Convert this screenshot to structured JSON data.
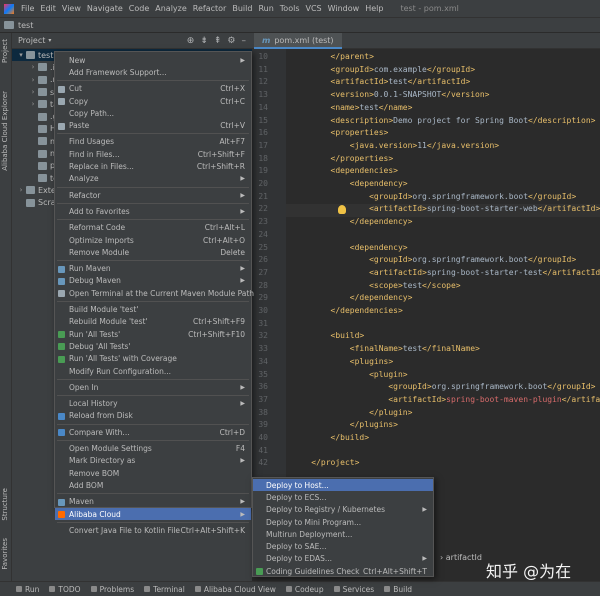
{
  "window": {
    "title": "test - pom.xml"
  },
  "menubar": [
    "File",
    "Edit",
    "View",
    "Navigate",
    "Code",
    "Analyze",
    "Refactor",
    "Build",
    "Run",
    "Tools",
    "VCS",
    "Window",
    "Help"
  ],
  "navbar": {
    "project": "test"
  },
  "left_tabs": [
    "Project",
    "Alibaba Cloud Explorer",
    "Structure",
    "Favorites"
  ],
  "project_panel": {
    "title": "Project",
    "tree": [
      {
        "label": "test",
        "arrow": "▾",
        "selected": true
      },
      {
        "label": ".id",
        "arrow": "›"
      },
      {
        "label": ".m",
        "arrow": "›"
      },
      {
        "label": "sr",
        "arrow": "›"
      },
      {
        "label": "ta",
        "arrow": "›"
      },
      {
        "label": ".gi",
        "arrow": ""
      },
      {
        "label": "HE",
        "arrow": ""
      },
      {
        "label": "m",
        "arrow": ""
      },
      {
        "label": "m",
        "arrow": ""
      },
      {
        "label": "pc",
        "arrow": ""
      },
      {
        "label": "te",
        "arrow": ""
      },
      {
        "label": "Exter",
        "arrow": "›"
      },
      {
        "label": "Scrat",
        "arrow": ""
      }
    ]
  },
  "editor": {
    "tab": "pom.xml (test)",
    "first_line": 10,
    "current_line": 22,
    "lines": [
      [
        {
          "c": "tag",
          "t": "        </parent>"
        }
      ],
      [
        {
          "c": "tag",
          "t": "        <groupId>"
        },
        {
          "c": "txt",
          "t": "com.example"
        },
        {
          "c": "tag",
          "t": "</groupId>"
        }
      ],
      [
        {
          "c": "tag",
          "t": "        <artifactId>"
        },
        {
          "c": "txt",
          "t": "test"
        },
        {
          "c": "tag",
          "t": "</artifactId>"
        }
      ],
      [
        {
          "c": "tag",
          "t": "        <version>"
        },
        {
          "c": "txt",
          "t": "0.0.1-SNAPSHOT"
        },
        {
          "c": "tag",
          "t": "</version>"
        }
      ],
      [
        {
          "c": "tag",
          "t": "        <name>"
        },
        {
          "c": "txt",
          "t": "test"
        },
        {
          "c": "tag",
          "t": "</name>"
        }
      ],
      [
        {
          "c": "tag",
          "t": "        <description>"
        },
        {
          "c": "txt",
          "t": "Demo project for Spring Boot"
        },
        {
          "c": "tag",
          "t": "</description>"
        }
      ],
      [
        {
          "c": "tag",
          "t": "        <properties>"
        }
      ],
      [
        {
          "c": "tag",
          "t": "            <java.version>"
        },
        {
          "c": "txt",
          "t": "11"
        },
        {
          "c": "tag",
          "t": "</java.version>"
        }
      ],
      [
        {
          "c": "tag",
          "t": "        </properties>"
        }
      ],
      [
        {
          "c": "tag",
          "t": "        <dependencies>"
        }
      ],
      [
        {
          "c": "tag",
          "t": "            <dependency>"
        }
      ],
      [
        {
          "c": "tag",
          "t": "                <groupId>"
        },
        {
          "c": "txt",
          "t": "org.springframework.boot"
        },
        {
          "c": "tag",
          "t": "</groupId>"
        }
      ],
      [
        {
          "c": "tag",
          "t": "                <artifactId>"
        },
        {
          "c": "txt",
          "t": "spring-boot-starter-web"
        },
        {
          "c": "tag",
          "t": "</artifactId>"
        }
      ],
      [
        {
          "c": "tag",
          "t": "            </dependency>"
        }
      ],
      [
        {
          "c": "txt",
          "t": ""
        }
      ],
      [
        {
          "c": "tag",
          "t": "            <dependency>"
        }
      ],
      [
        {
          "c": "tag",
          "t": "                <groupId>"
        },
        {
          "c": "txt",
          "t": "org.springframework.boot"
        },
        {
          "c": "tag",
          "t": "</groupId>"
        }
      ],
      [
        {
          "c": "tag",
          "t": "                <artifactId>"
        },
        {
          "c": "txt",
          "t": "spring-boot-starter-test"
        },
        {
          "c": "tag",
          "t": "</artifactId>"
        }
      ],
      [
        {
          "c": "tag",
          "t": "                <scope>"
        },
        {
          "c": "txt",
          "t": "test"
        },
        {
          "c": "tag",
          "t": "</scope>"
        }
      ],
      [
        {
          "c": "tag",
          "t": "            </dependency>"
        }
      ],
      [
        {
          "c": "tag",
          "t": "        </dependencies>"
        }
      ],
      [
        {
          "c": "txt",
          "t": ""
        }
      ],
      [
        {
          "c": "tag",
          "t": "        <build>"
        }
      ],
      [
        {
          "c": "tag",
          "t": "            <finalName>"
        },
        {
          "c": "txt",
          "t": "test"
        },
        {
          "c": "tag",
          "t": "</finalName>"
        }
      ],
      [
        {
          "c": "tag",
          "t": "            <plugins>"
        }
      ],
      [
        {
          "c": "tag",
          "t": "                <plugin>"
        }
      ],
      [
        {
          "c": "tag",
          "t": "                    <groupId>"
        },
        {
          "c": "txt",
          "t": "org.springframework.boot"
        },
        {
          "c": "tag",
          "t": "</groupId>"
        }
      ],
      [
        {
          "c": "tag",
          "t": "                    <artifactId>"
        },
        {
          "c": "red",
          "t": "spring-boot-maven-plugin"
        },
        {
          "c": "tag",
          "t": "</artifactId>"
        }
      ],
      [
        {
          "c": "tag",
          "t": "                </plugin>"
        }
      ],
      [
        {
          "c": "tag",
          "t": "            </plugins>"
        }
      ],
      [
        {
          "c": "tag",
          "t": "        </build>"
        }
      ],
      [
        {
          "c": "txt",
          "t": ""
        }
      ],
      [
        {
          "c": "tag",
          "t": "    </project>"
        }
      ]
    ]
  },
  "breadcrumb": "artifactId",
  "context_menu": [
    {
      "label": "New",
      "sub": true
    },
    {
      "label": "Add Framework Support..."
    },
    {
      "sep": true
    },
    {
      "label": "Cut",
      "shortcut": "Ctrl+X",
      "icon": "cut-icon"
    },
    {
      "label": "Copy",
      "shortcut": "Ctrl+C",
      "icon": "copy-icon"
    },
    {
      "label": "Copy Path..."
    },
    {
      "label": "Paste",
      "shortcut": "Ctrl+V",
      "icon": "paste-icon"
    },
    {
      "sep": true
    },
    {
      "label": "Find Usages",
      "shortcut": "Alt+F7"
    },
    {
      "label": "Find in Files...",
      "shortcut": "Ctrl+Shift+F"
    },
    {
      "label": "Replace in Files...",
      "shortcut": "Ctrl+Shift+R"
    },
    {
      "label": "Analyze",
      "sub": true
    },
    {
      "sep": true
    },
    {
      "label": "Refactor",
      "sub": true
    },
    {
      "sep": true
    },
    {
      "label": "Add to Favorites",
      "sub": true
    },
    {
      "sep": true
    },
    {
      "label": "Reformat Code",
      "shortcut": "Ctrl+Alt+L"
    },
    {
      "label": "Optimize Imports",
      "shortcut": "Ctrl+Alt+O"
    },
    {
      "label": "Remove Module",
      "shortcut": "Delete"
    },
    {
      "sep": true
    },
    {
      "label": "Run Maven",
      "sub": true,
      "icon": "maven-icon"
    },
    {
      "label": "Debug Maven",
      "sub": true,
      "icon": "maven-icon"
    },
    {
      "label": "Open Terminal at the Current Maven Module Path",
      "icon": "terminal-icon"
    },
    {
      "sep": true
    },
    {
      "label": "Build Module 'test'"
    },
    {
      "label": "Rebuild Module 'test'",
      "shortcut": "Ctrl+Shift+F9"
    },
    {
      "label": "Run 'All Tests'",
      "shortcut": "Ctrl+Shift+F10",
      "icon": "run-icon"
    },
    {
      "label": "Debug 'All Tests'",
      "icon": "debug-icon"
    },
    {
      "label": "Run 'All Tests' with Coverage",
      "icon": "coverage-icon"
    },
    {
      "label": "Modify Run Configuration..."
    },
    {
      "sep": true
    },
    {
      "label": "Open In",
      "sub": true
    },
    {
      "sep": true
    },
    {
      "label": "Local History",
      "sub": true
    },
    {
      "label": "Reload from Disk",
      "icon": "reload-icon"
    },
    {
      "sep": true
    },
    {
      "label": "Compare With...",
      "shortcut": "Ctrl+D",
      "icon": "compare-icon"
    },
    {
      "sep": true
    },
    {
      "label": "Open Module Settings",
      "shortcut": "F4"
    },
    {
      "label": "Mark Directory as",
      "sub": true
    },
    {
      "label": "Remove BOM"
    },
    {
      "label": "Add BOM"
    },
    {
      "sep": true
    },
    {
      "label": "Maven",
      "sub": true,
      "icon": "maven-icon"
    },
    {
      "label": "Alibaba Cloud",
      "sub": true,
      "selected": true,
      "icon": "alibaba-cloud-icon"
    },
    {
      "sep": true
    },
    {
      "label": "Convert Java File to Kotlin File",
      "shortcut": "Ctrl+Alt+Shift+K"
    }
  ],
  "sub_menu": [
    {
      "label": "Deploy to Host...",
      "selected": true
    },
    {
      "label": "Deploy to ECS..."
    },
    {
      "label": "Deploy to Registry / Kubernetes",
      "sub": true
    },
    {
      "label": "Deploy to Mini Program..."
    },
    {
      "label": "Multirun Deployment..."
    },
    {
      "label": "Deploy to SAE..."
    },
    {
      "label": "Deploy to EDAS...",
      "sub": true
    },
    {
      "label": "Coding Guidelines Check",
      "shortcut": "Ctrl+Alt+Shift+T",
      "icon": "guidelines-icon"
    }
  ],
  "statusbar": [
    {
      "label": "Run",
      "icon": "run-icon"
    },
    {
      "label": "TODO",
      "icon": "todo-icon"
    },
    {
      "label": "Problems",
      "icon": "problems-icon"
    },
    {
      "label": "Terminal",
      "icon": "terminal-icon"
    },
    {
      "label": "Alibaba Cloud View",
      "icon": "alibaba-cloud-icon"
    },
    {
      "label": "Codeup",
      "icon": "codeup-icon"
    },
    {
      "label": "Services",
      "icon": "services-icon"
    },
    {
      "label": "Build",
      "icon": "build-icon"
    }
  ],
  "watermark": "知乎 @为在",
  "colors": {
    "accent": "#4b6eaf",
    "tag": "#e8bf6a",
    "text": "#a9b7c6",
    "error": "#d76b6b",
    "background": "#2b2b2b",
    "chrome": "#3c3f41"
  }
}
